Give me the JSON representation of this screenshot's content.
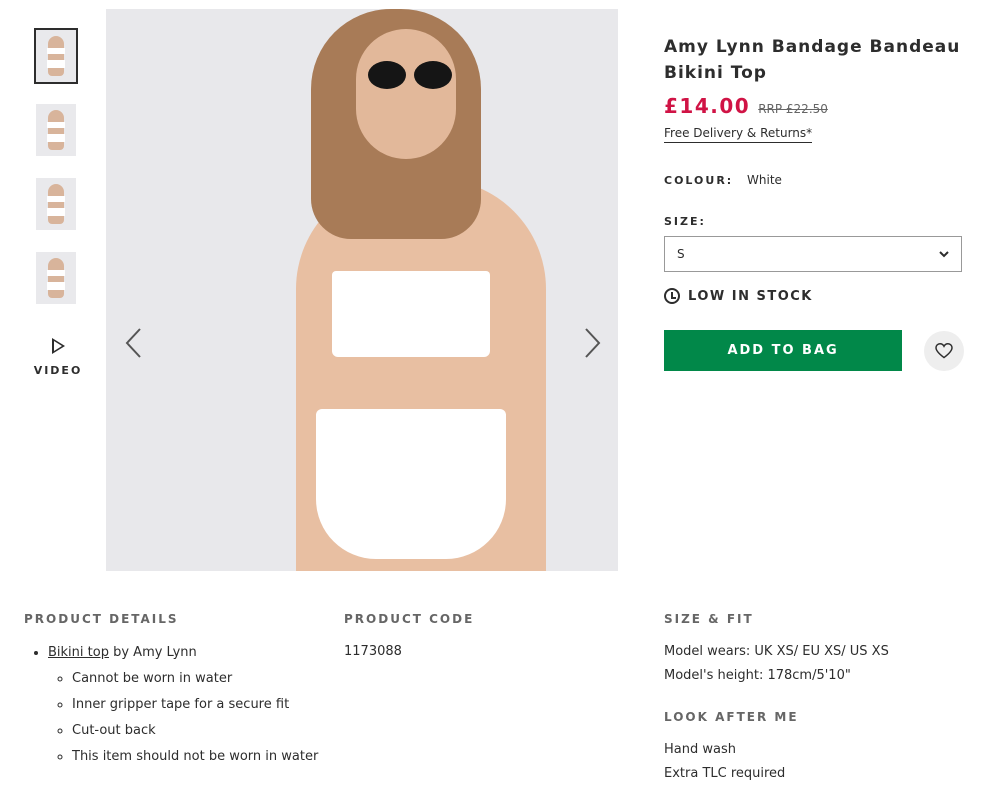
{
  "thumbnails": [
    {
      "label": "product image 1"
    },
    {
      "label": "product image 2"
    },
    {
      "label": "product image 3"
    },
    {
      "label": "product image 4"
    }
  ],
  "video": {
    "label": "VIDEO"
  },
  "product": {
    "title": "Amy Lynn Bandage Bandeau Bikini Top",
    "price": "£14.00",
    "rrp": "RRP £22.50",
    "delivery": "Free Delivery & Returns*",
    "colour_label": "COLOUR:",
    "colour_value": "White",
    "size_label": "SIZE:",
    "size_value": "S",
    "stock": "LOW IN STOCK",
    "add_to_bag": "ADD TO BAG"
  },
  "details": {
    "heading": "PRODUCT DETAILS",
    "link_text": "Bikini top",
    "by_text": " by Amy Lynn",
    "bullets": [
      "Cannot be worn in water",
      "Inner gripper tape for a secure fit",
      "Cut-out back",
      "This item should not be worn in water"
    ]
  },
  "code": {
    "heading": "PRODUCT CODE",
    "value": "1173088"
  },
  "size_fit": {
    "heading": "SIZE & FIT",
    "line1": "Model wears: UK XS/ EU XS/ US XS",
    "line2": "Model's height: 178cm/5'10\""
  },
  "care": {
    "heading": "LOOK AFTER ME",
    "line1": "Hand wash",
    "line2": "Extra TLC required"
  },
  "colors": {
    "price": "#d01345",
    "add_to_bag_bg": "#018849"
  }
}
